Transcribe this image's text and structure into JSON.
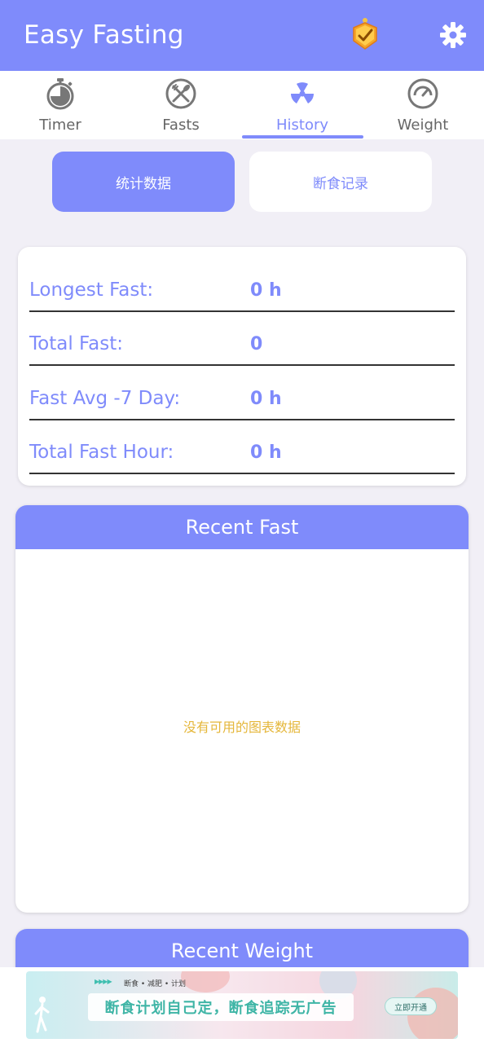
{
  "app": {
    "title": "Easy Fasting"
  },
  "tabs": [
    {
      "label": "Timer",
      "icon": "stopwatch-icon",
      "active": false
    },
    {
      "label": "Fasts",
      "icon": "fork-knife-icon",
      "active": false
    },
    {
      "label": "History",
      "icon": "radiation-icon",
      "active": true
    },
    {
      "label": "Weight",
      "icon": "scale-gauge-icon",
      "active": false
    }
  ],
  "segments": {
    "stats": "统计数据",
    "records": "断食记录"
  },
  "stats": [
    {
      "label": "Longest Fast:",
      "value": "0 h"
    },
    {
      "label": "Total Fast:",
      "value": "0"
    },
    {
      "label": "Fast Avg -7 Day:",
      "value": "0 h"
    },
    {
      "label": "Total Fast Hour:",
      "value": "0 h"
    }
  ],
  "recent_fast": {
    "title": "Recent Fast",
    "empty_message": "没有可用的图表数据"
  },
  "recent_weight": {
    "title": "Recent Weight"
  },
  "ad": {
    "tagline": "断食 • 减肥 • 计划",
    "headline": "断食计划自己定，断食追踪无广告",
    "cta": "立即开通"
  },
  "colors": {
    "accent": "#7f8bfb",
    "background": "#f1eff6",
    "empty_text": "#e5b73b"
  }
}
